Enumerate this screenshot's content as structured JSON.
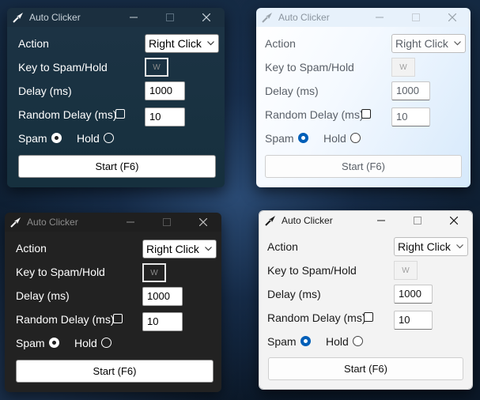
{
  "colors": {
    "accent": "#005fb8",
    "dark_window_bg": "#222222",
    "teal_window_bg": "#1b3142",
    "light_window_bg": "#f3f3f3"
  },
  "windows": [
    {
      "theme": "dark-teal",
      "title": "Auto Clicker",
      "controls": [
        "minimize-icon",
        "maximize-icon",
        "close-icon"
      ],
      "action_label": "Action",
      "action_value": "Right Click",
      "key_label": "Key to Spam/Hold",
      "key_value": "W",
      "delay_label": "Delay (ms)",
      "delay_value": "1000",
      "random_label": "Random Delay (ms)",
      "random_checked": false,
      "random_value": "10",
      "spam_label": "Spam",
      "spam_selected": true,
      "hold_label": "Hold",
      "hold_selected": false,
      "start_label": "Start (F6)"
    },
    {
      "theme": "light-blue",
      "title": "Auto Clicker",
      "controls": [
        "minimize-icon",
        "maximize-icon",
        "close-icon"
      ],
      "action_label": "Action",
      "action_value": "Right Click",
      "key_label": "Key to Spam/Hold",
      "key_value": "W",
      "delay_label": "Delay (ms)",
      "delay_value": "1000",
      "random_label": "Random Delay (ms)",
      "random_checked": false,
      "random_value": "10",
      "spam_label": "Spam",
      "spam_selected": true,
      "hold_label": "Hold",
      "hold_selected": false,
      "start_label": "Start (F6)"
    },
    {
      "theme": "dark",
      "title": "Auto Clicker",
      "controls": [
        "minimize-icon",
        "maximize-icon",
        "close-icon"
      ],
      "action_label": "Action",
      "action_value": "Right Click",
      "key_label": "Key to Spam/Hold",
      "key_value": "W",
      "delay_label": "Delay (ms)",
      "delay_value": "1000",
      "random_label": "Random Delay (ms)",
      "random_checked": false,
      "random_value": "10",
      "spam_label": "Spam",
      "spam_selected": true,
      "hold_label": "Hold",
      "hold_selected": false,
      "start_label": "Start (F6)"
    },
    {
      "theme": "light",
      "title": "Auto Clicker",
      "controls": [
        "minimize-icon",
        "maximize-icon",
        "close-icon"
      ],
      "action_label": "Action",
      "action_value": "Right Click",
      "key_label": "Key to Spam/Hold",
      "key_value": "W",
      "delay_label": "Delay (ms)",
      "delay_value": "1000",
      "random_label": "Random Delay (ms)",
      "random_checked": false,
      "random_value": "10",
      "spam_label": "Spam",
      "spam_selected": true,
      "hold_label": "Hold",
      "hold_selected": false,
      "start_label": "Start (F6)"
    }
  ]
}
